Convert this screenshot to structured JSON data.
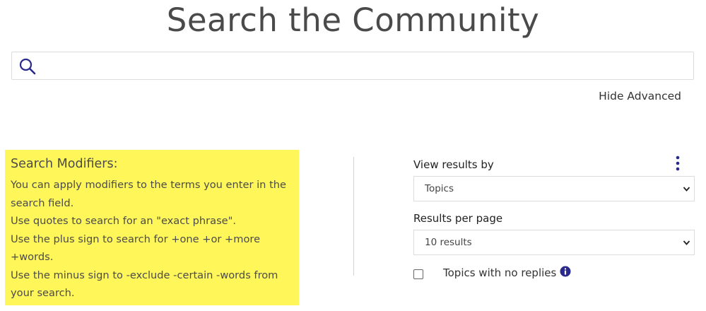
{
  "page": {
    "title": "Search the Community"
  },
  "search": {
    "value": "",
    "placeholder": "",
    "icon": "search-icon"
  },
  "advanced": {
    "toggle_label": "Hide Advanced"
  },
  "modifiers": {
    "heading": "Search Modifiers:",
    "background_color": "#fff65a",
    "lines": [
      "You can apply modifiers to the terms you enter in the search field.",
      "Use quotes to search for an \"exact phrase\".",
      "Use the plus sign to search for +one +or +more +words.",
      "Use the minus sign to -exclude -certain -words from your search."
    ]
  },
  "options": {
    "view_results_label": "View results by",
    "view_results_value": "Topics",
    "results_per_page_label": "Results per page",
    "results_per_page_value": "10 results",
    "no_replies_label": "Topics with no replies",
    "no_replies_checked": false,
    "menu_icon": "vertical-ellipsis-icon",
    "info_icon": "info-icon",
    "accent_color": "#2a2a8c"
  }
}
